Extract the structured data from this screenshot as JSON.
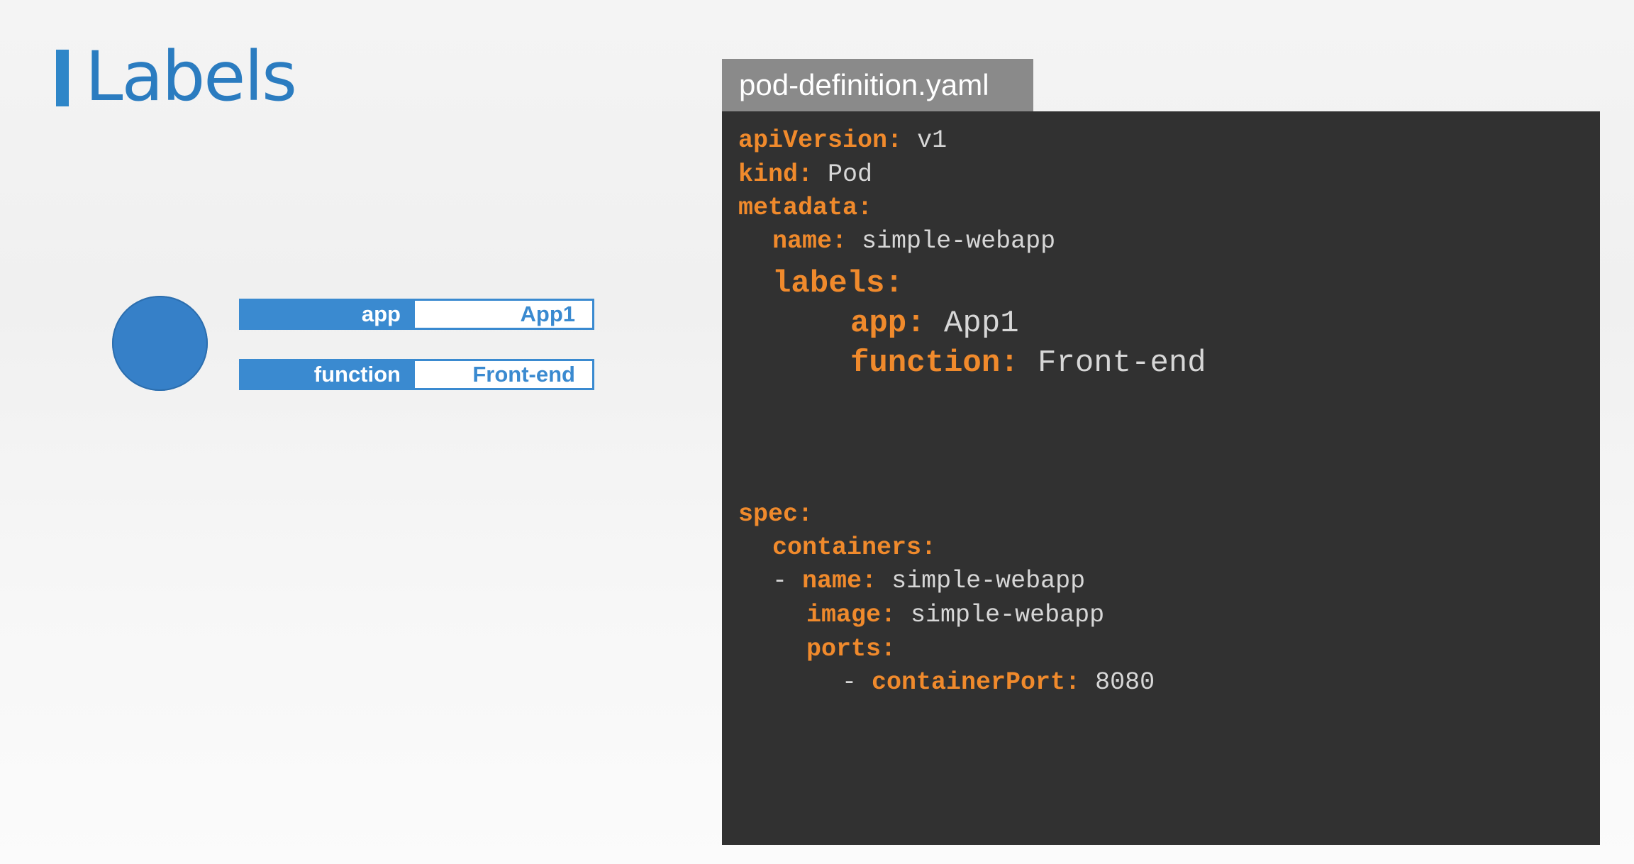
{
  "title": "Labels",
  "pod_labels": [
    {
      "key": "app",
      "value": "App1"
    },
    {
      "key": "function",
      "value": "Front-end"
    }
  ],
  "file_tab": "pod-definition.yaml",
  "code": {
    "apiVersion_key": "apiVersion:",
    "apiVersion_val": "v1",
    "kind_key": "kind:",
    "kind_val": "Pod",
    "metadata_key": "metadata:",
    "name_key": "name:",
    "name_val": "simple-webapp",
    "labels_key": "labels:",
    "app_key": "app:",
    "app_val": "App1",
    "function_key": "function:",
    "function_val": "Front-end",
    "spec_key": "spec:",
    "containers_key": "containers:",
    "dash1": "- ",
    "container_name_key": "name:",
    "container_name_val": "simple-webapp",
    "image_key": "image:",
    "image_val": "simple-webapp",
    "ports_key": "ports:",
    "dash2": "- ",
    "containerPort_key": "containerPort:",
    "containerPort_val": "8080"
  },
  "colors": {
    "accent": "#2b7cc0",
    "label_blue": "#3a8ad0",
    "code_bg": "#313131",
    "code_key": "#f08a2c",
    "code_value": "#d7d7d7",
    "tab_bg": "#8a8a8a"
  }
}
